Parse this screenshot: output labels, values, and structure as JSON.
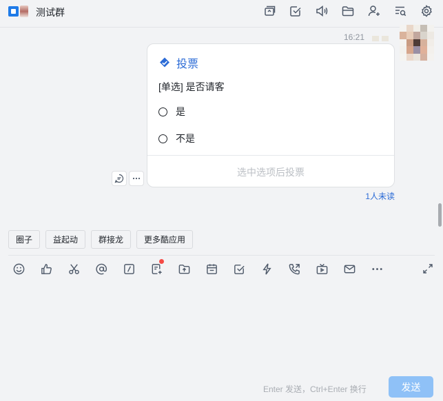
{
  "header": {
    "group_name": "测试群",
    "icons": [
      "screen-share-icon",
      "task-check-icon",
      "announcement-icon",
      "folder-icon",
      "add-member-icon",
      "search-history-icon",
      "settings-gear-icon"
    ]
  },
  "message": {
    "time": "16:21",
    "vote": {
      "label": "投票",
      "question": "[单选] 是否请客",
      "options": [
        "是",
        "不是"
      ],
      "submit_label": "选中选项后投票"
    },
    "unread_label": "1人未读",
    "actions": [
      "reply-icon",
      "more-icon"
    ]
  },
  "quick_apps": [
    "圈子",
    "益起动",
    "群接龙",
    "更多酷应用"
  ],
  "composer": {
    "tools": [
      "emoji-icon",
      "thumbs-up-icon",
      "scissors-icon",
      "mention-icon",
      "slash-command-icon",
      "doc-add-icon",
      "upload-icon",
      "calendar-icon",
      "todo-icon",
      "lightning-icon",
      "call-icon",
      "live-icon",
      "mail-icon",
      "more-icon"
    ],
    "hint": "Enter 发送，Ctrl+Enter 换行",
    "send_label": "发送"
  },
  "colors": {
    "accent": "#2b6bd6",
    "send_button": "#8fc1f7",
    "background": "#f2f3f5",
    "badge_red": "#f54a45"
  }
}
